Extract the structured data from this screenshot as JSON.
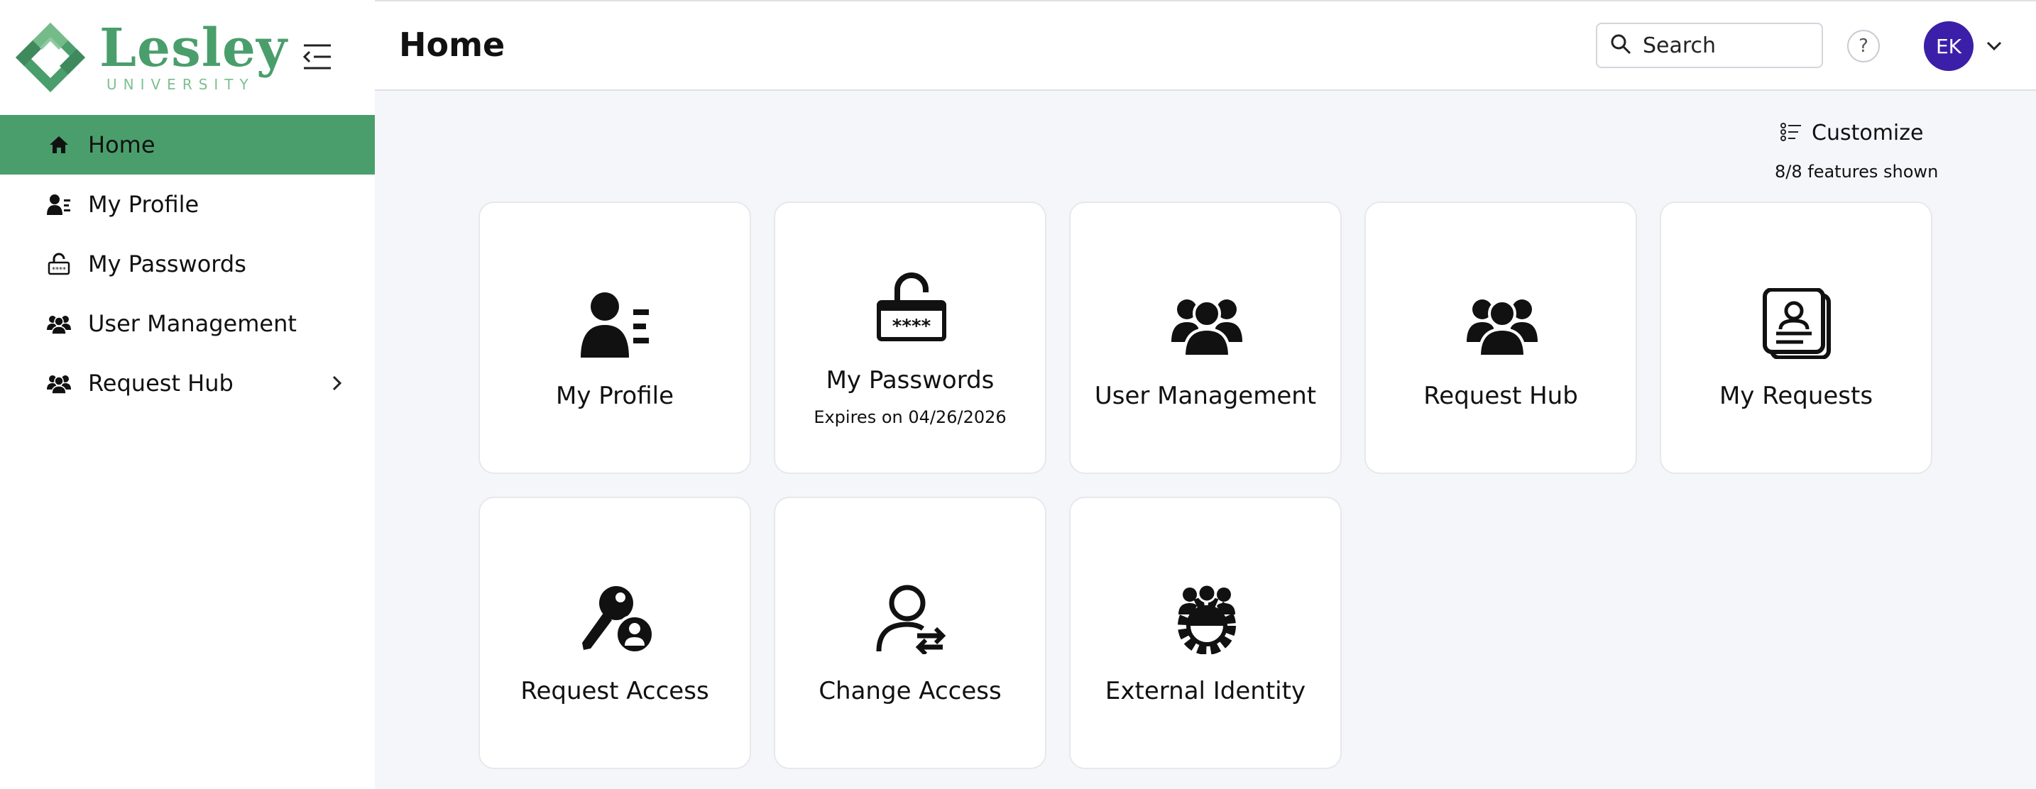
{
  "brand": {
    "name": "Lesley",
    "subtitle": "UNIVERSITY",
    "primary_color": "#4a9e6c",
    "light_color": "#7cc08f"
  },
  "header": {
    "title": "Home",
    "search_label": "Search",
    "help_label": "?",
    "user_initials": "EK",
    "avatar_color": "#3b1fa8"
  },
  "sidebar": {
    "items": [
      {
        "label": "Home",
        "icon": "home-icon",
        "active": true
      },
      {
        "label": "My Profile",
        "icon": "profile-icon"
      },
      {
        "label": "My Passwords",
        "icon": "password-lock-icon"
      },
      {
        "label": "User Management",
        "icon": "users-icon"
      },
      {
        "label": "Request Hub",
        "icon": "users-icon",
        "has_submenu": true
      }
    ]
  },
  "main": {
    "customize_label": "Customize",
    "features_shown": "8/8 features shown",
    "cards": [
      {
        "label": "My Profile",
        "icon": "profile-icon"
      },
      {
        "label": "My Passwords",
        "sub": "Expires on 04/26/2026",
        "icon": "password-lock-icon"
      },
      {
        "label": "User Management",
        "icon": "users-icon"
      },
      {
        "label": "Request Hub",
        "icon": "users-icon"
      },
      {
        "label": "My Requests",
        "icon": "requests-icon"
      },
      {
        "label": "Request Access",
        "icon": "key-user-icon"
      },
      {
        "label": "Change Access",
        "icon": "user-swap-icon"
      },
      {
        "label": "External Identity",
        "icon": "users-gear-icon"
      }
    ]
  }
}
